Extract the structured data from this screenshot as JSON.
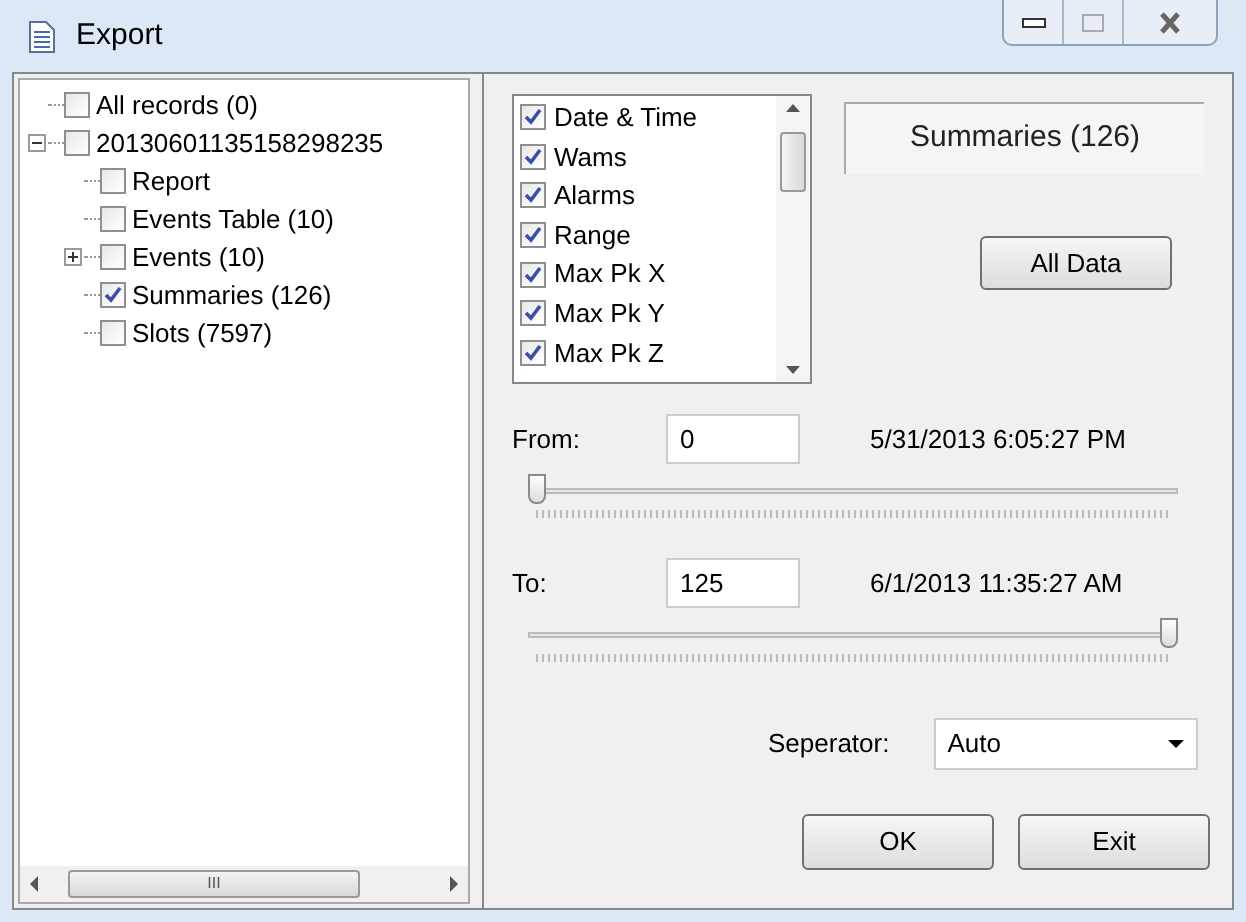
{
  "window": {
    "title": "Export"
  },
  "tree": [
    {
      "label": "All records (0)",
      "checked": false
    },
    {
      "label": "20130601135158298235",
      "checked": false,
      "expanded": true,
      "children": [
        {
          "label": "Report",
          "checked": false
        },
        {
          "label": "Events Table (10)",
          "checked": false
        },
        {
          "label": "Events (10)",
          "checked": false,
          "expanded": false
        },
        {
          "label": "Summaries (126)",
          "checked": true
        },
        {
          "label": "Slots (7597)",
          "checked": false
        }
      ]
    }
  ],
  "fields": [
    {
      "label": "Date & Time",
      "checked": true
    },
    {
      "label": "Wams",
      "checked": true
    },
    {
      "label": "Alarms",
      "checked": true
    },
    {
      "label": "Range",
      "checked": true
    },
    {
      "label": "Max Pk X",
      "checked": true
    },
    {
      "label": "Max Pk Y",
      "checked": true
    },
    {
      "label": "Max Pk Z",
      "checked": true
    }
  ],
  "summary_label": "Summaries (126)",
  "all_data_button": "All Data",
  "ranges": [
    {
      "label": "From:",
      "value": "0",
      "timestamp": "5/31/2013 6:05:27 PM",
      "level": 0
    },
    {
      "label": "To:",
      "value": "125",
      "timestamp": "6/1/2013 11:35:27 AM",
      "level": 1
    }
  ],
  "separator": {
    "label": "Seperator:",
    "value": "Auto"
  },
  "buttons": [
    "OK",
    "Exit"
  ],
  "tree_scrollbar_thumb": "III"
}
